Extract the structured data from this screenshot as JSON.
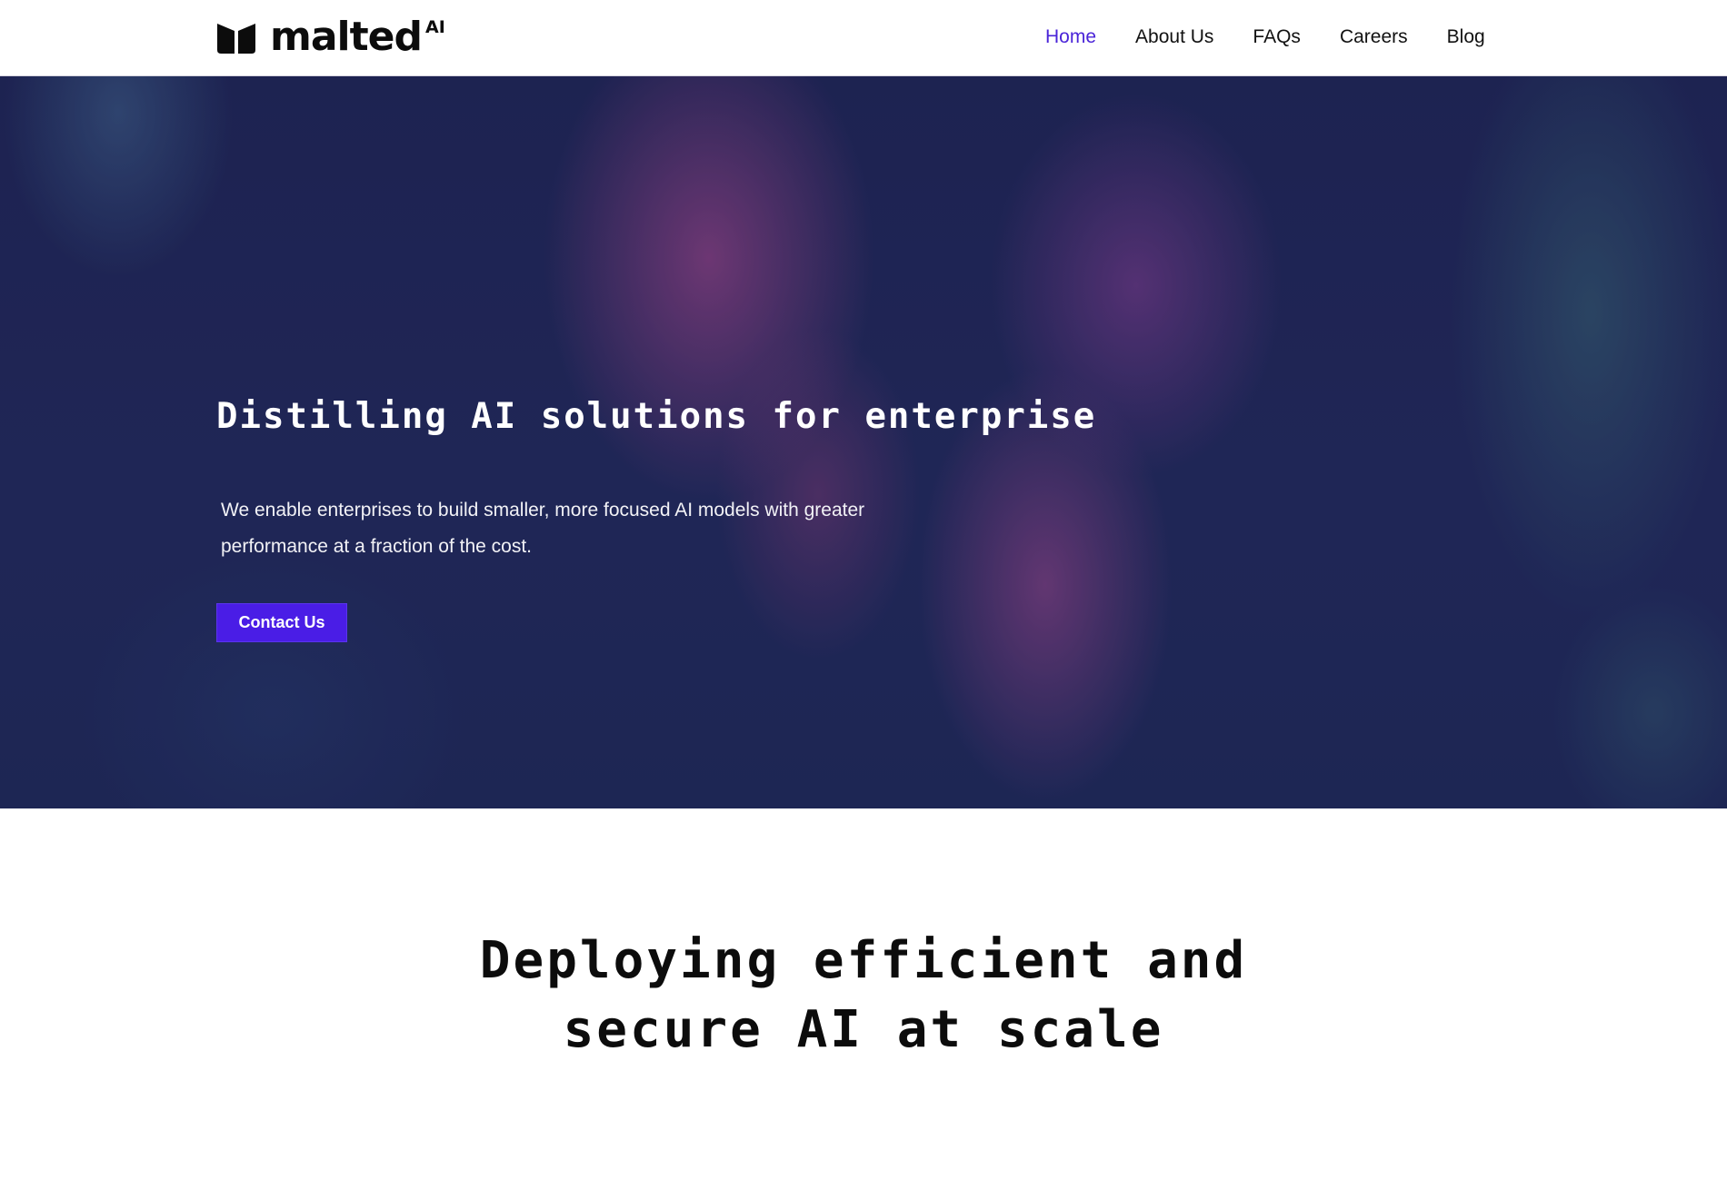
{
  "nav": {
    "logo": {
      "wordmark": "malted",
      "superscript": "AI",
      "icon": "book-icon"
    },
    "links": [
      {
        "label": "Home",
        "active": true
      },
      {
        "label": "About Us",
        "active": false
      },
      {
        "label": "FAQs",
        "active": false
      },
      {
        "label": "Careers",
        "active": false
      },
      {
        "label": "Blog",
        "active": false
      }
    ]
  },
  "hero": {
    "title": "Distilling AI solutions for enterprise",
    "description": "We enable enterprises to build smaller, more focused AI models with greater performance at a fraction of the cost.",
    "cta_label": "Contact Us"
  },
  "section2": {
    "title_line1": "Deploying efficient and",
    "title_line2": "secure AI at scale"
  },
  "colors": {
    "accent": "#4a1de6",
    "active_link": "#4a24d8",
    "hero_base": "#1f2656"
  }
}
